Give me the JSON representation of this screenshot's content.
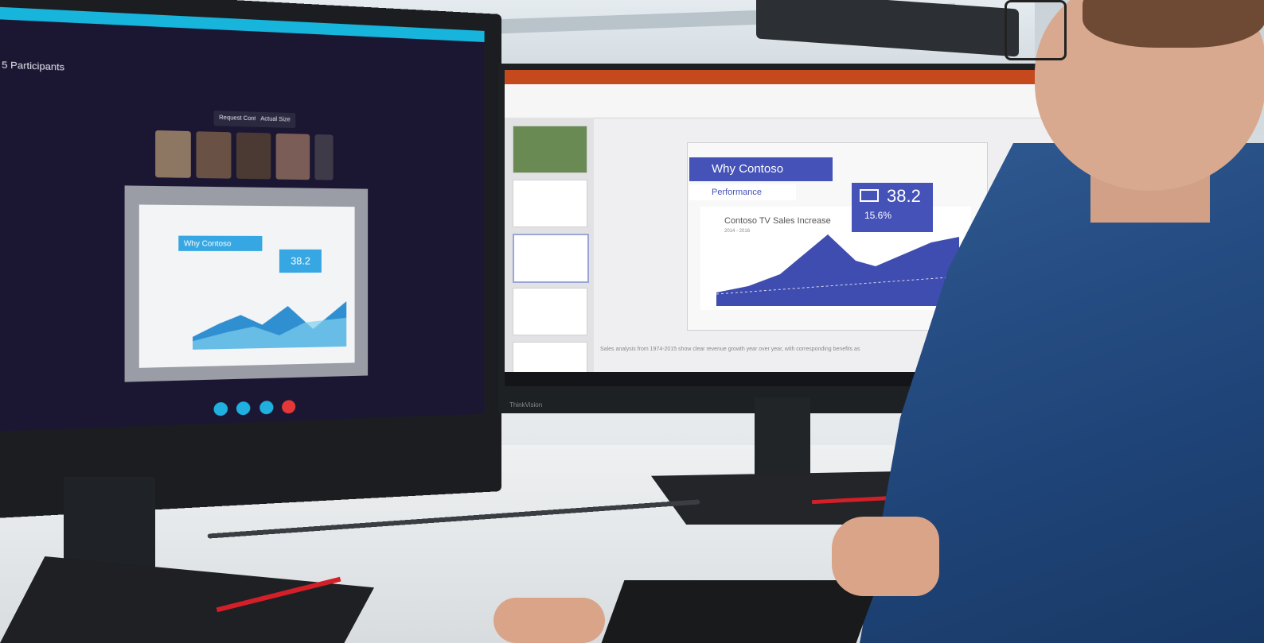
{
  "left_screen": {
    "participants_label": "5 Participants",
    "buttons": [
      "Request Control",
      "Actual Size"
    ],
    "shared_slide": {
      "title": "Why Contoso",
      "stat": "38.2"
    }
  },
  "right_screen": {
    "slide": {
      "title": "Why Contoso",
      "subtitle": "Performance",
      "stat_value": "38.2",
      "stat_change": "15.6%",
      "chart_title": "Contoso TV Sales Increase",
      "chart_years": "2014 - 2016"
    },
    "notes_text": "Sales analysis from 1974-2015 show clear revenue growth year over year, with corresponding benefits as"
  },
  "brand": "ThinkVision",
  "colors": {
    "accent_blue": "#4552b8",
    "skype_cyan": "#17b4dc",
    "ppt_orange": "#c44a1e",
    "stripe_red": "#d31f28",
    "shirt_blue": "#2a5288"
  }
}
